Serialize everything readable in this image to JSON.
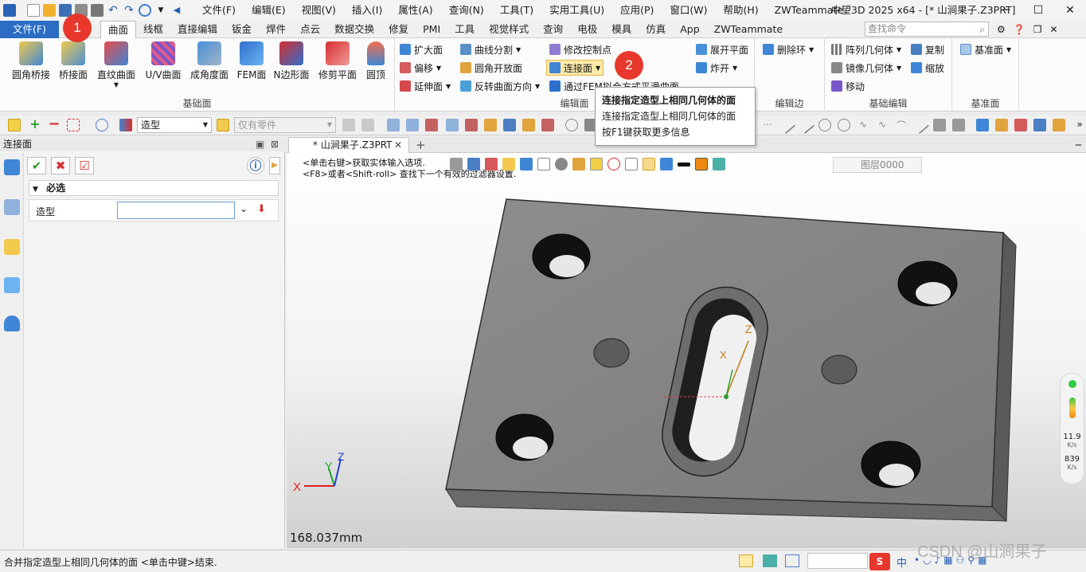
{
  "titlebar": {
    "menus": [
      "文件(F)",
      "编辑(E)",
      "视图(V)",
      "插入(I)",
      "属性(A)",
      "查询(N)",
      "工具(T)",
      "实用工具(U)",
      "应用(P)",
      "窗口(W)",
      "帮助(H)",
      "ZWTeammate"
    ],
    "title": "中望3D 2025 x64 - [* 山涧果子.Z3PRT]"
  },
  "ribbon_tabs": {
    "file": "文件(F)",
    "tabs": [
      "曲面",
      "线框",
      "直接编辑",
      "钣金",
      "焊件",
      "点云",
      "数据交换",
      "修复",
      "PMI",
      "工具",
      "视觉样式",
      "查询",
      "电极",
      "模具",
      "仿真",
      "App",
      "ZWTeammate"
    ],
    "active": "曲面",
    "search_placeholder": "查找命令"
  },
  "ribbon": {
    "groups": {
      "basic_surface": "基础面",
      "edit_surface": "编辑面",
      "edit_edge": "编辑边",
      "basic_edit": "基础编辑",
      "datum": "基准面"
    },
    "big_buttons": [
      "圆角桥接",
      "桥接面",
      "直纹曲面",
      "U/V曲面",
      "成角度面",
      "FEM面",
      "N边形面",
      "修剪平面",
      "圆顶"
    ],
    "edit_buttons": {
      "extend_face": "扩大面",
      "curve_split": "曲线分割",
      "modify_ctrl_pts": "修改控制点",
      "offset": "偏移",
      "fillet_open": "圆角开放面",
      "connect_face": "连接面",
      "extend_face2": "延伸面",
      "reverse_dir": "反转曲面方向",
      "through_fem": "通过FEM拟合方式平滑曲面",
      "unfold_plane": "展开平面",
      "explode": "炸开"
    },
    "edge_buttons": {
      "delete_ring": "删除环"
    },
    "basic_edit_buttons": {
      "array": "阵列几何体",
      "copy": "复制",
      "mirror": "镜像几何体",
      "scale": "缩放",
      "move": "移动"
    },
    "datum_buttons": {
      "datum": "基准面"
    }
  },
  "badges": {
    "one": "1",
    "two": "2"
  },
  "tooltip": {
    "title": "连接指定造型上相同几何体的面",
    "desc": "连接指定造型上相同几何体的面",
    "help": "按F1键获取更多信息"
  },
  "toolbar": {
    "filter_value": "造型",
    "scope_value": "仅有零件"
  },
  "left_panel": {
    "title": "连接面",
    "section_required": "必选",
    "field_label": "造型",
    "field_value": ""
  },
  "viewport": {
    "doc_tab": "* 山涧果子.Z3PRT",
    "hint_line1": "<单击右键>获取实体输入选项.",
    "hint_line2": "<F8>或者<Shift-roll> 查找下一个有效的过滤器设置.",
    "layer": "图层0000",
    "measurement": "168.037mm",
    "axis_x": "X",
    "axis_y": "Y",
    "axis_z": "Z",
    "perf_fps": "11.9",
    "perf_unit1": "K/s",
    "perf_tris": "839",
    "perf_unit2": "K/s"
  },
  "statusbar": {
    "text": "合并指定造型上相同几何体的面 <单击中键>结束.",
    "ime": "中"
  },
  "watermark": "CSDN @山涧果子",
  "colors": {
    "file_tab": "#2b6cc4",
    "badge": "#e8372c",
    "highlight": "#fde9a8",
    "part_top": "#8a8a8a",
    "part_side": "#5e5e5e"
  }
}
